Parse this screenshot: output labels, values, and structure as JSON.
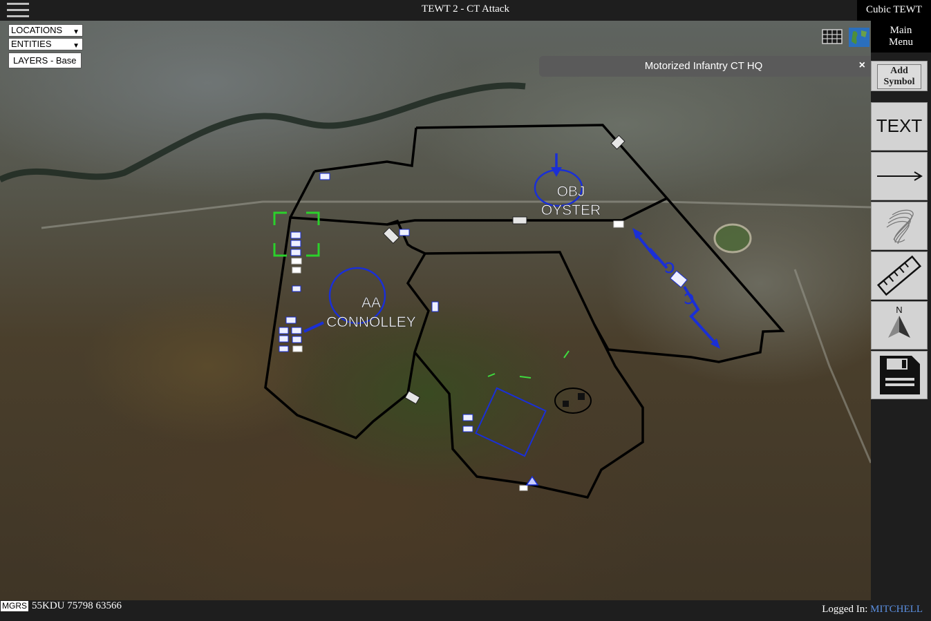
{
  "app": {
    "title": "TEWT 2 - CT Attack",
    "brand": "Cubic TEWT"
  },
  "map_controls": {
    "locations_select": "LOCATIONS",
    "entities_select": "ENTITIES",
    "layers_button": "LAYERS - Base"
  },
  "entity_panel": {
    "title": "Motorized Infantry CT HQ",
    "close_label": "×"
  },
  "map_labels": {
    "obj_line1": "OBJ",
    "obj_line2": "OYSTER",
    "aa_line1": "AA",
    "aa_line2": "CONNOLLEY"
  },
  "toolbar": {
    "main_menu_line1": "Main",
    "main_menu_line2": "Menu",
    "add_symbol_line1": "Add",
    "add_symbol_line2": "Symbol",
    "text_tool": "TEXT",
    "north_label": "N"
  },
  "footer": {
    "coord_system": "MGRS",
    "coordinate": "55KDU 75798 63566",
    "logged_in_label": "Logged In:",
    "username": "MITCHELL"
  },
  "colors": {
    "control_measure": "#0a0a0a",
    "friendly_graphics": "#1a2fd6",
    "selection_box": "#2bd12b",
    "username_link": "#5b8fe0"
  }
}
